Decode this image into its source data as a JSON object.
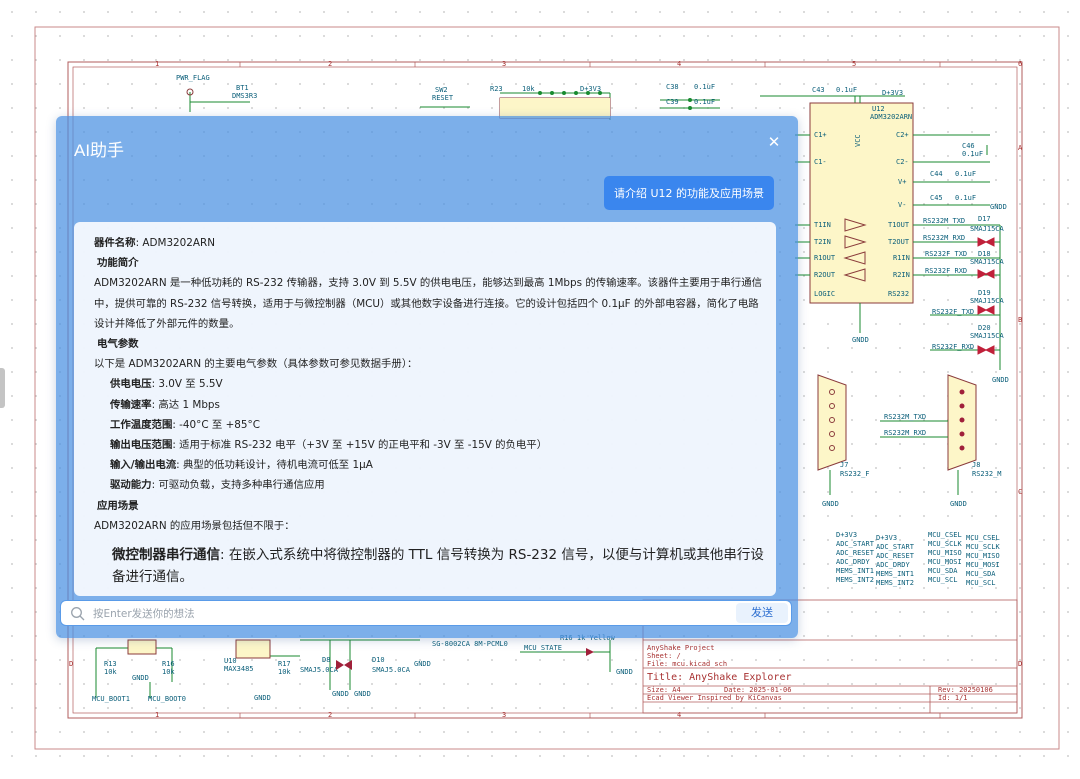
{
  "panel": {
    "title": "AI助手",
    "close_symbol": "✕",
    "user_message": "请介绍 U12 的功能及应用场景",
    "input_placeholder": "按Enter发送你的想法",
    "send_label": "发送"
  },
  "answer": {
    "name_label": "器件名称",
    "name_value": ": ADM3202ARN",
    "func_heading": "功能简介",
    "func_text": "ADM3202ARN 是一种低功耗的 RS-232 传输器，支持 3.0V 到 5.5V 的供电电压，能够达到最高 1Mbps 的传输速率。该器件主要用于串行通信中，提供可靠的 RS-232 信号转换，适用于与微控制器（MCU）或其他数字设备进行连接。它的设计包括四个 0.1μF 的外部电容器，简化了电路设计并降低了外部元件的数量。",
    "elec_heading": "电气参数",
    "elec_intro": "以下是 ADM3202ARN 的主要电气参数（具体参数可参见数据手册）：",
    "params": [
      {
        "label": "供电电压",
        "value": ": 3.0V 至 5.5V"
      },
      {
        "label": "传输速率",
        "value": ": 高达 1 Mbps"
      },
      {
        "label": "工作温度范围",
        "value": ": -40°C 至 +85°C"
      },
      {
        "label": "输出电压范围",
        "value": ": 适用于标准 RS-232 电平（+3V 至 +15V 的正电平和 -3V 至 -15V 的负电平）"
      },
      {
        "label": "输入/输出电流",
        "value": ": 典型的低功耗设计，待机电流可低至 1μA"
      },
      {
        "label": "驱动能力",
        "value": ": 可驱动负载，支持多种串行通信应用"
      }
    ],
    "app_heading": "应用场景",
    "app_intro": "ADM3202ARN 的应用场景包括但不限于：",
    "app_item_label": "微控制器串行通信",
    "app_item_value": ": 在嵌入式系统中将微控制器的 TTL 信号转换为 RS-232 信号，以便与计算机或其他串行设备进行通信。"
  },
  "schematic": {
    "ref_u12": "U12",
    "part_u12": "ADM3202ARN",
    "pins_left": [
      "C1+",
      "C1-",
      "T1IN",
      "T2IN",
      "R1OUT",
      "R2OUT",
      "LOGIC"
    ],
    "pins_right": [
      "C2+",
      "C2-",
      "V+",
      "V-",
      "T1OUT",
      "T2OUT",
      "R1IN",
      "R2IN",
      "RS232"
    ],
    "pin_vcc": "VCC",
    "pin_gnd": "GND",
    "caps": [
      "C43",
      "0.1uF",
      "C46",
      "0.1uF",
      "C44",
      "0.1uF",
      "C45",
      "0.1uF",
      "C38",
      "0.1uF",
      "C39",
      "0.1uF"
    ],
    "diodes": [
      "D17",
      "SMAJ15CA",
      "D18",
      "SMAJ15CA",
      "D19",
      "SMAJ15CA",
      "D20",
      "SMAJ15CA"
    ],
    "nets_rs232": [
      "RS232M_TXD",
      "RS232M_RXD",
      "RS232F_TXD",
      "RS232F_RXD"
    ],
    "connectors": [
      "J7",
      "RS232_F",
      "J8",
      "RS232_M"
    ],
    "top_parts": [
      "PWR_FLAG",
      "BT1",
      "DMS3R3",
      "SW2",
      "RESET",
      "R23",
      "10k",
      "D+3V3"
    ],
    "gnd": "GNDD",
    "mcu_nets_left": [
      "D+3V3",
      "ADC_START",
      "ADC_RESET",
      "ADC_DRDY",
      "MEMS_INT1",
      "MEMS_INT2"
    ],
    "mcu_nets_right": [
      "MCU_CSEL",
      "MCU_SCLK",
      "MCU_MISO",
      "MCU_MOSI",
      "MCU_SDA",
      "MCU_SCL"
    ],
    "bottom_parts": [
      "R13",
      "10k",
      "R16",
      "10k",
      "U10",
      "MAX3485",
      "R17",
      "10k",
      "D8",
      "SMAJ5.0CA",
      "D10",
      "SMAJ5.0CA",
      "MCU_BOOT1",
      "MCU_BOOT0",
      "SG-8002CA 8M-PCML0",
      "MCU_STATE",
      "R16 1k Yellow"
    ],
    "title_block": {
      "project": "AnyShake Project",
      "sheet": "Sheet: /",
      "file": "File: mcu.kicad_sch",
      "title": "Title: AnyShake Explorer",
      "size": "Size: A4",
      "date": "Date: 2025-01-06",
      "rev": "Rev: 20250106",
      "viewer": "Ecad Viewer Inspired by KiCanvas",
      "id": "Id: 1/1"
    },
    "col_numbers": [
      "1",
      "2",
      "3",
      "4",
      "5",
      "6"
    ],
    "row_letters": [
      "A",
      "B",
      "C",
      "D"
    ]
  },
  "colors": {
    "panel_bg": "#4a90e2",
    "bubble": "#3a86ee",
    "frame_red": "#b25c5c",
    "wire_green": "#188a2f",
    "sch_blue": "#0b5f7a"
  }
}
